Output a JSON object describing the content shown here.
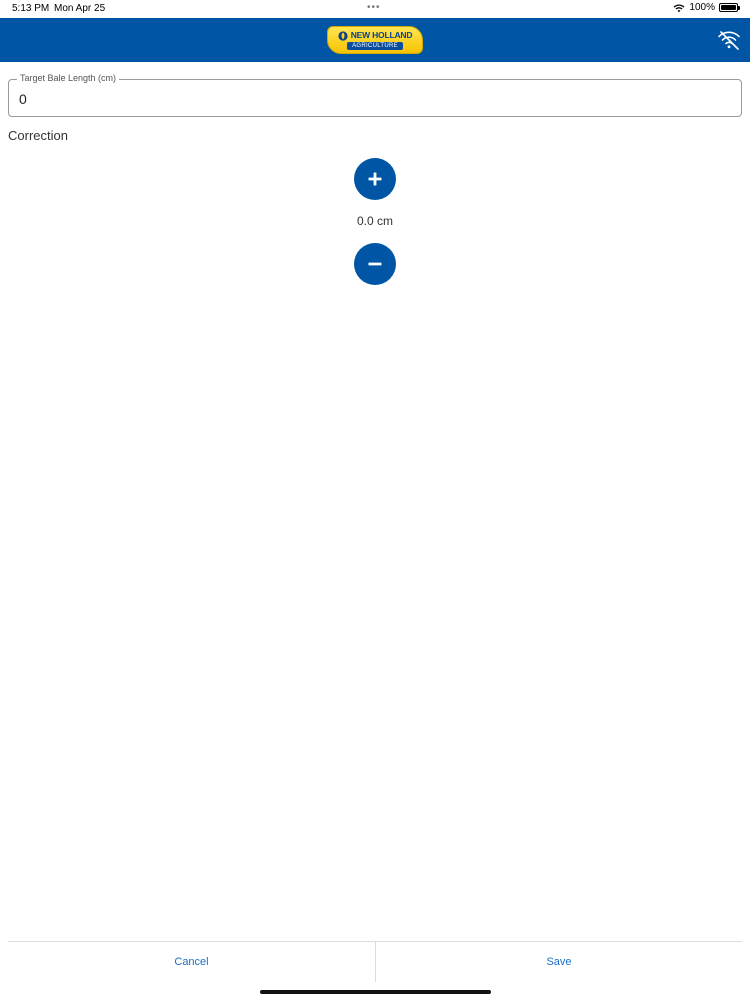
{
  "status_bar": {
    "time": "5:13 PM",
    "date": "Mon Apr 25",
    "dots": "•••",
    "battery_text": "100%"
  },
  "header": {
    "logo_name": "NEW HOLLAND",
    "logo_sub": "AGRICULTURE",
    "background_color": "#0055a5",
    "offline_icon": "wifi-off-icon"
  },
  "form": {
    "target_field": {
      "label": "Target Bale Length (cm)",
      "value": "0"
    },
    "correction": {
      "label": "Correction",
      "value": "0.0 cm",
      "increment_icon": "plus-icon",
      "decrement_icon": "minus-icon"
    }
  },
  "footer": {
    "cancel_label": "Cancel",
    "save_label": "Save",
    "link_color": "#1a6fc9"
  }
}
